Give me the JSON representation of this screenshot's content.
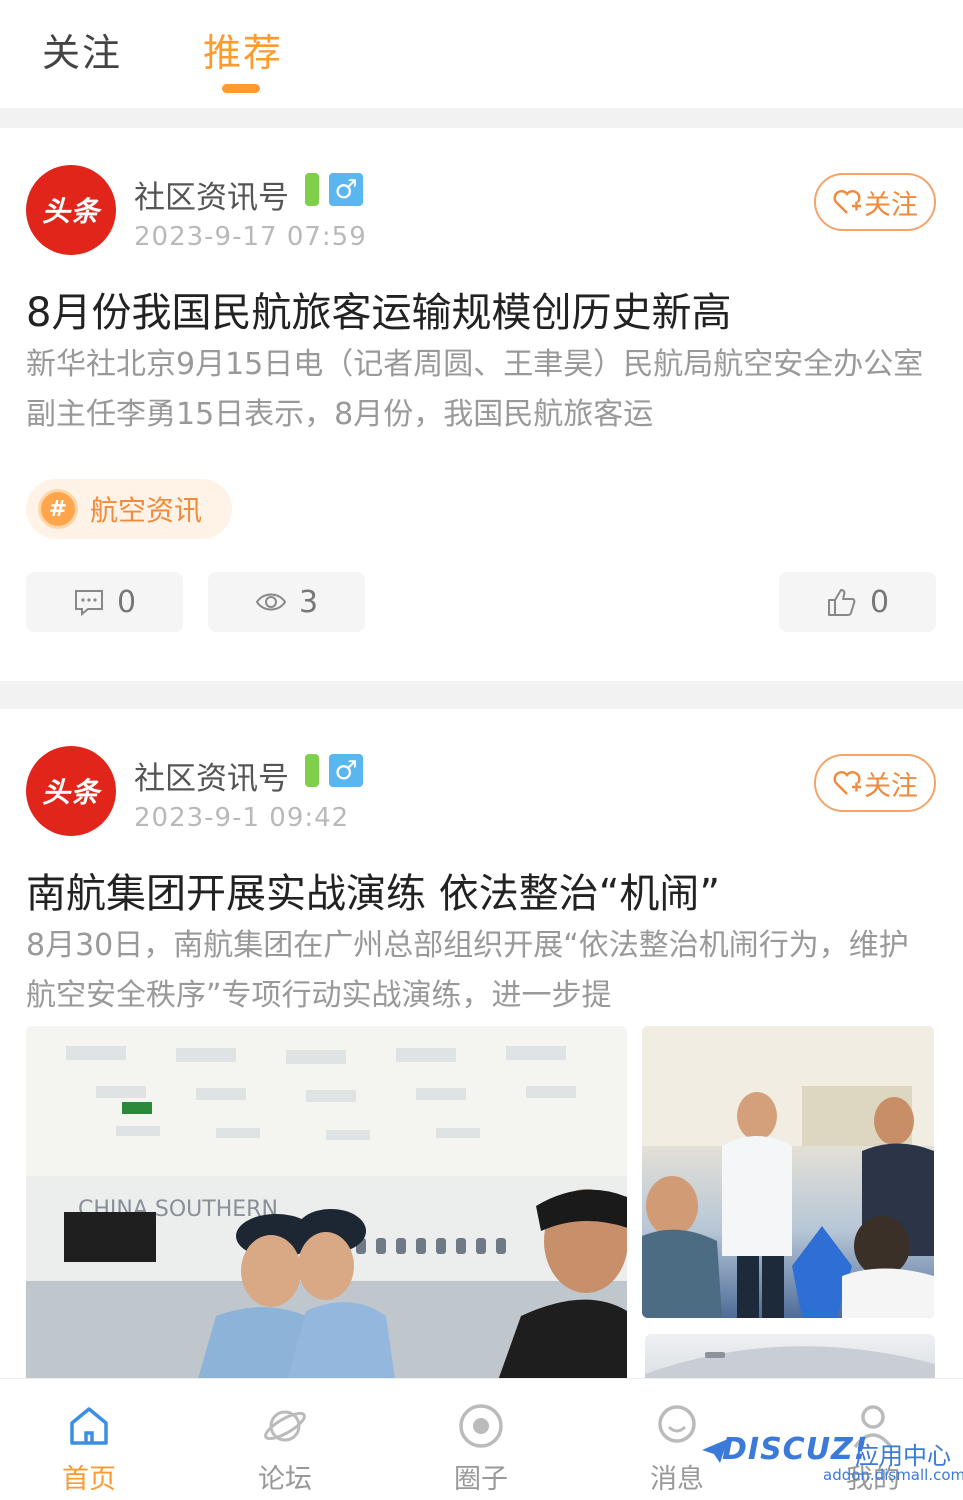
{
  "tabs": [
    {
      "label": "关注",
      "active": false
    },
    {
      "label": "推荐",
      "active": true
    }
  ],
  "posts": [
    {
      "avatar_text": "头条",
      "author": "社区资讯号",
      "gender_icon": "♂",
      "time": "2023-9-17 07:59",
      "follow_label": "关注",
      "title": "8月份我国民航旅客运输规模创历史新高",
      "excerpt": "新华社北京9月15日电（记者周圆、王聿昊）民航局航空安全办公室副主任李勇15日表示，8月份，我国民航旅客运",
      "topic_icon": "#",
      "topic": "航空资讯",
      "comments": "0",
      "views": "3",
      "likes": "0"
    },
    {
      "avatar_text": "头条",
      "author": "社区资讯号",
      "gender_icon": "♂",
      "time": "2023-9-1 09:42",
      "follow_label": "关注",
      "title": "南航集团开展实战演练 依法整治“机闹”",
      "excerpt": "8月30日，南航集团在广州总部组织开展“依法整治机闹行为，维护航空安全秩序”专项行动实战演练，进一步提",
      "photo_text": "CHINA SOUTHERN"
    }
  ],
  "bottom_nav": [
    {
      "label": "首页",
      "icon": "home-icon",
      "active": true
    },
    {
      "label": "论坛",
      "icon": "planet-icon",
      "active": false
    },
    {
      "label": "圈子",
      "icon": "circle-icon",
      "active": false
    },
    {
      "label": "消息",
      "icon": "message-icon",
      "active": false
    },
    {
      "label": "我的",
      "icon": "user-icon",
      "active": false
    }
  ],
  "watermark": {
    "logo": "DISCUZ!",
    "text": "应用中心",
    "url": "addon.dismall.com"
  },
  "colors": {
    "accent": "#ff9a2e",
    "avatar_bg": "#e1251b"
  }
}
